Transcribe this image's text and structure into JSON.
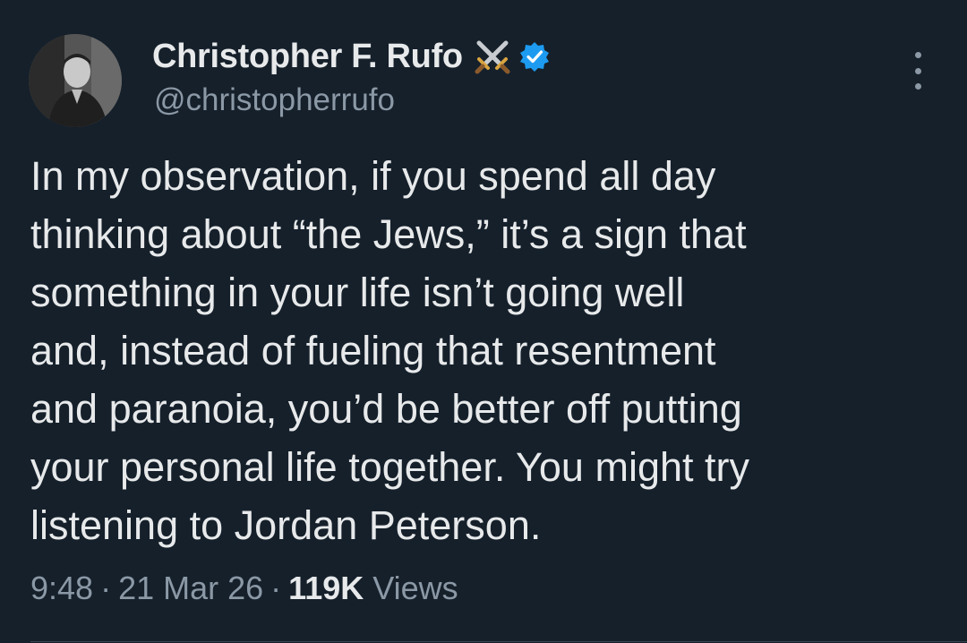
{
  "author": {
    "display_name": "Christopher F. Rufo",
    "handle": "@christopherrufo",
    "name_emoji": "crossed-swords-icon",
    "verified_badge": "verified-badge-icon",
    "verified_color": "#1d9bf0"
  },
  "tweet": {
    "lines": [
      "In my observation, if you spend all day",
      "thinking about “the Jews,” it’s a sign that",
      "something in your life isn’t going well",
      "and, instead of fueling that resentment",
      "and paranoia, you’d be better off putting",
      "your personal life together. You might try",
      "listening to Jordan Peterson."
    ]
  },
  "meta": {
    "time": "9:48",
    "separator": "·",
    "date": "21 Mar 26",
    "views_count": "119K",
    "views_label": "Views"
  },
  "colors": {
    "background": "#15202b",
    "primary_text": "#e7e9ea",
    "secondary_text": "#8b98a5"
  },
  "icons": {
    "more": "more-options-icon"
  }
}
